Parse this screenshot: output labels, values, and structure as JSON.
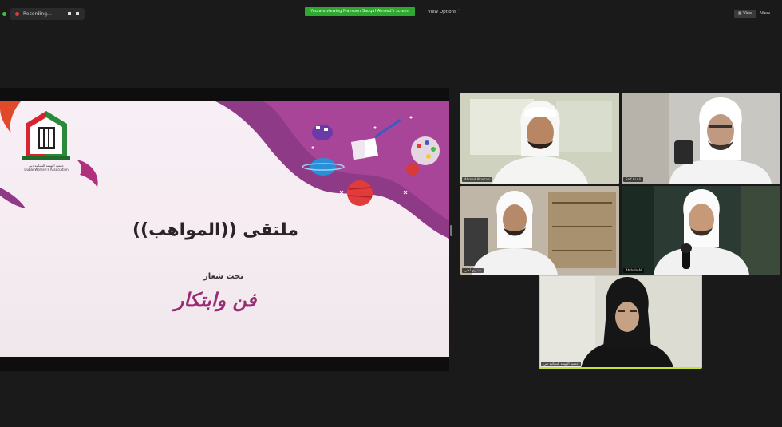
{
  "toolbar": {
    "recording_label": "Recording...",
    "screen_share_banner": "You are viewing Maysoon Saqqaf Ahmed's screen",
    "view_options_label": "View Options ˅",
    "view_button_label": "▦ View",
    "view_right_label": "View"
  },
  "slide": {
    "title": "ملتقى ((المواهب))",
    "subtitle": "تحت شعار",
    "slogan": "فن وابتكار",
    "org_name_ar": "جمعية النهضة النسائية دبي",
    "org_name_en": "Dubai Women's Association"
  },
  "participants": [
    {
      "name": "Ahmed Alhosani"
    },
    {
      "name": "Saif Al Ali"
    },
    {
      "name": "مشاري أهلي"
    },
    {
      "name": "Abdulla Al"
    },
    {
      "name": "جمعية النهضة النسائية دبي"
    }
  ],
  "colors": {
    "app_background": "#1a1a1a",
    "screen_share_banner": "#2ea82e",
    "active_speaker_border": "#c4e23a",
    "slogan_purple": "#9a2b74"
  }
}
